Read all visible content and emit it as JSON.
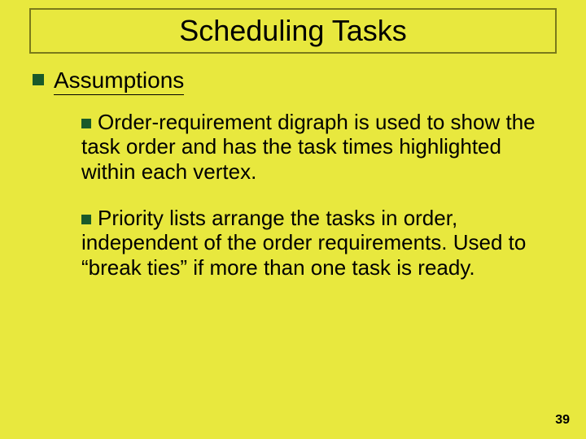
{
  "slide": {
    "title": "Scheduling Tasks",
    "heading": "Assumptions",
    "bullets": [
      "Order-requirement digraph is used to show the task order and has the task times highlighted within each vertex.",
      "Priority lists arrange the tasks in order, independent of the order requirements.  Used to “break ties” if more than one task is ready."
    ],
    "page_number": "39"
  }
}
